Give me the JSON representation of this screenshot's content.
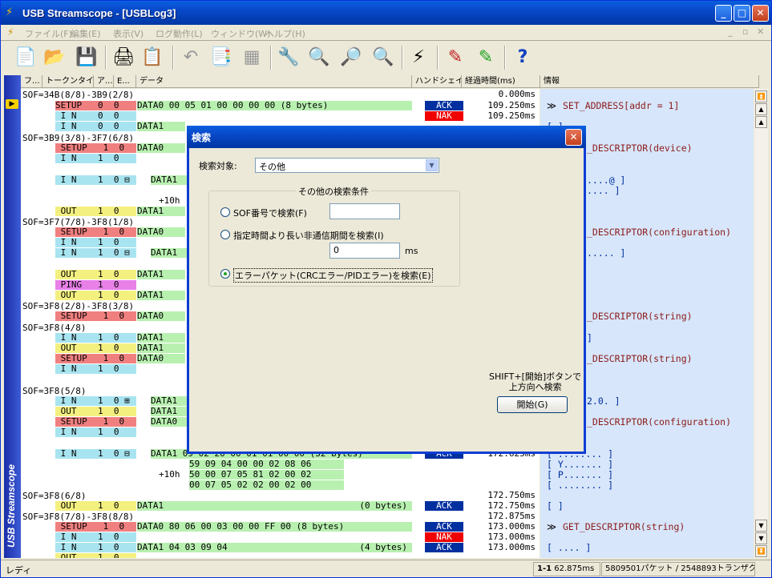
{
  "window": {
    "title": "USB Streamscope - [USBLog3]"
  },
  "menu": [
    "ファイル(F)",
    "編集(E)",
    "表示(V)",
    "ログ動作(L)",
    "ウィンドウ(W)",
    "ヘルプ(H)"
  ],
  "columns": {
    "c1": "フ...",
    "c2": "トークンタイプ",
    "c3": "ア...",
    "c4": "E...",
    "c5": "データ",
    "c6": "ハンドシェイク",
    "c7": "経過時間(ms)",
    "c8": "情報"
  },
  "sidebar_label": "USB Streamscope",
  "grid": {
    "sof1": "SOF=34B(8/8)-3B9(2/8)",
    "sof2": "SOF=3B9(3/8)-3F7(6/8)",
    "sof3": "SOF=3F7(7/8)-3F8(1/8)",
    "sof4": "SOF=3F8(2/8)-3F8(3/8)",
    "sof5": "SOF=3F8(4/8)",
    "sof6": "SOF=3F8(5/8)",
    "sof7": "SOF=3F8(6/8)",
    "sof8": "SOF=3F8(7/8)-3F8(8/8)",
    "r1_data": "DATA0 00 05 01 00 00 00 00 (8 bytes)",
    "r1_time": "0.000ms",
    "r2_time": "109.250ms",
    "r3_time": "109.250ms",
    "r_mid_data": "DATA1 09 02 20 00 01 01 00 00 (32 bytes)",
    "r_mid_time": "172.625ms",
    "hex1": "59 09 04 00 00 02 08 06",
    "hex2": "50 00 07 05 81 02 00 02",
    "hex3": "00 07 05 02 02 00 02 00",
    "offset10h": "+10h",
    "out_zero": "(0 bytes)",
    "t_1725": "172.750ms",
    "t_17275": "172.750ms",
    "setup_data2": "DATA0 80 06 00 03 00 00 FF 00 (8 bytes)",
    "t_173a": "173.000ms",
    "t_173b": "173.000ms",
    "in_data4": "DATA1 04 03 09 04",
    "bytes4": "(4 bytes)",
    "t_173c": "173.000ms",
    "t_172875": "172.875ms",
    "ack": "ACK",
    "nak": "NAK",
    "setup": "SETUP",
    "in": "I N",
    "out": "OUT",
    "ping": "PING",
    "data0": "DATA0",
    "data1": "DATA1"
  },
  "info": {
    "i1": "SET_ADDRESS[addr = 1]",
    "i2": "_DESCRIPTOR(device)",
    "i3": "_DESCRIPTOR(configuration)",
    "i4": "_DESCRIPTOR(string)",
    "i5": "_DESCRIPTOR(string)",
    "i6": "_DESCRIPTOR(configuration)",
    "i7": "GET_DESCRIPTOR(string)",
    "b1": "[ ]",
    "b2": "....@ ]",
    "b3": ".... ]",
    "b4": "..... ]",
    "b5": "]",
    "b6": "2.0. ]",
    "b7": "[ Y....... ]",
    "b8": "[ P....... ]",
    "b9": "[ ]",
    "b10": "[ .... ]"
  },
  "dialog": {
    "title": "検索",
    "target_label": "検索対象:",
    "target_value": "その他",
    "group_title": "その他の検索条件",
    "opt1": "SOF番号で検索(F)",
    "opt2": "指定時間より長い非通信期間を検索(I)",
    "opt2_value": "0",
    "opt2_unit": "ms",
    "opt3": "エラーパケット(CRCエラー/PIDエラー)を検索(E)",
    "hint": "SHIFT+[開始]ボタンで\n上方向へ検索",
    "start_button": "開始(G)"
  },
  "status": {
    "left": "レディ",
    "pos": "1-1",
    "elapsed": "62.875ms",
    "counts": "5809501パケット / 2548893トランザクション"
  }
}
